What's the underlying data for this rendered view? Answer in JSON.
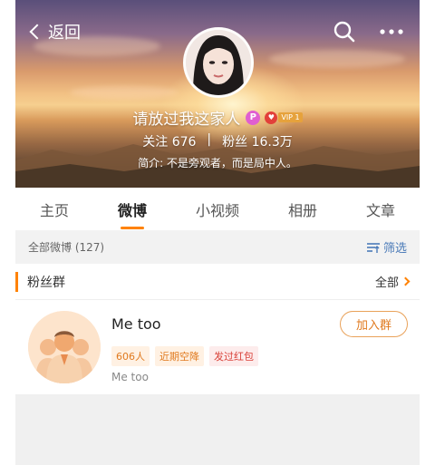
{
  "header": {
    "back_label": "返回",
    "profile": {
      "name": "请放过我这家人",
      "p_badge": "P",
      "vip_label": "VIP 1",
      "following_label": "关注",
      "following_count": "676",
      "fans_label": "粉丝",
      "fans_count": "16.3万",
      "bio": "简介: 不是旁观者，而是局中人。"
    }
  },
  "tabs": [
    {
      "label": "主页",
      "active": false
    },
    {
      "label": "微博",
      "active": true
    },
    {
      "label": "小视频",
      "active": false
    },
    {
      "label": "相册",
      "active": false
    },
    {
      "label": "文章",
      "active": false
    }
  ],
  "filter_bar": {
    "all_weibo": "全部微博 (127)",
    "filter_label": "筛选"
  },
  "fan_group": {
    "section_title": "粉丝群",
    "all_link": "全部",
    "group": {
      "name": "Me too",
      "tags": [
        "606人",
        "近期空降",
        "发过红包"
      ],
      "description": "Me too",
      "join_label": "加入群"
    }
  },
  "colors": {
    "accent": "#ff8200",
    "link_blue": "#4a7ab8",
    "tag_orange": "#e07a1f",
    "tag_red": "#d9423a"
  }
}
